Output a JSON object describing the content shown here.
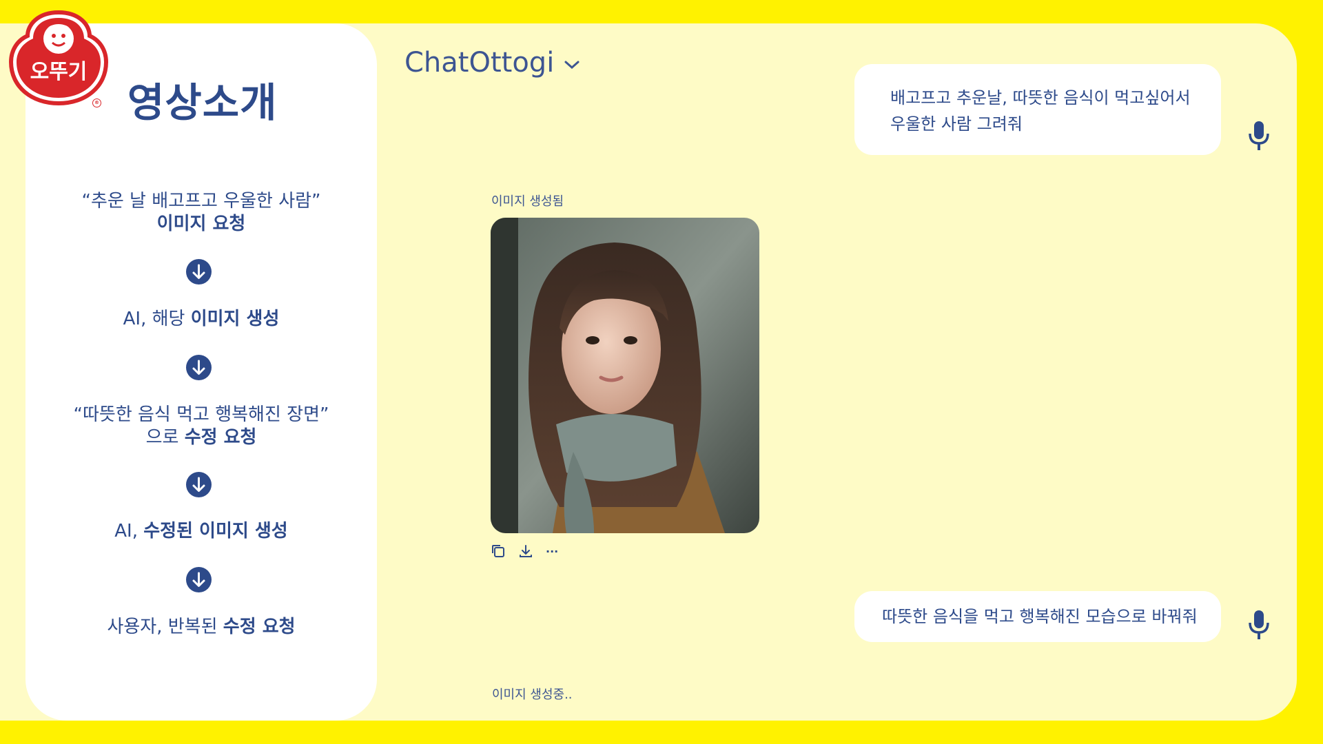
{
  "brand": {
    "logo_text": "오뚜기",
    "logo_registered": "®"
  },
  "sidebar": {
    "title": "영상소개",
    "steps": [
      {
        "line1": "“추운 날 배고프고 우울한 사람”",
        "plain": "",
        "bold": "이미지 요청"
      },
      {
        "plain": "AI, 해당 ",
        "bold": "이미지 생성"
      },
      {
        "line1": "“따뜻한 음식 먹고 행복해진 장면”",
        "plain": "으로 ",
        "bold": "수정 요청"
      },
      {
        "plain": "AI, ",
        "bold": "수정된 이미지 생성"
      },
      {
        "plain": "사용자, 반복된 ",
        "bold": "수정 요청"
      }
    ],
    "arrow_icon": "arrow-down-circle-icon"
  },
  "chat": {
    "title": "ChatOttogi",
    "messages": [
      {
        "role": "user",
        "text": "배고프고 추운날, 따뜻한 음식이 먹고싶어서 우울한 사람 그려줘"
      },
      {
        "role": "assistant",
        "status": "이미지 생성됨",
        "image_alt": "girl-in-scarf-illustration"
      },
      {
        "role": "user",
        "text": "따뜻한 음식을 먹고 행복해진 모습으로 바꿔줘"
      },
      {
        "role": "assistant",
        "status": "이미지 생성중.."
      }
    ],
    "image_actions": [
      "copy-icon",
      "download-icon",
      "more-icon"
    ],
    "more_label": "···"
  },
  "colors": {
    "background": "#fff200",
    "chat_bg": "#fefbc6",
    "accent": "#2d4a8a",
    "logo_red": "#d9262a"
  }
}
